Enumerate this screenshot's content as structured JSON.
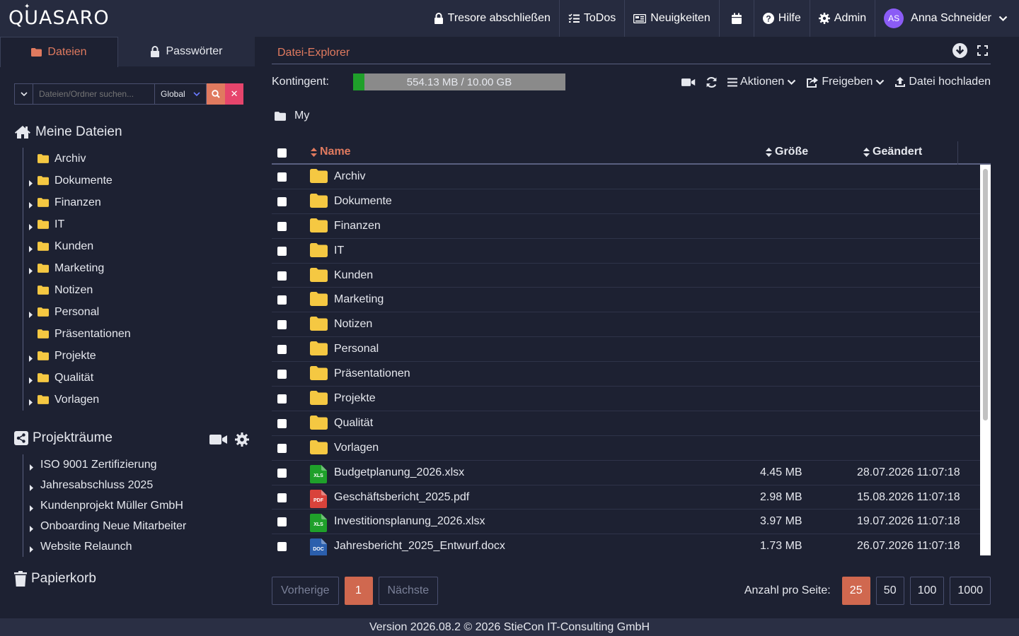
{
  "app": {
    "logo": "QUASARO"
  },
  "topnav": {
    "lock_vaults": "Tresore abschließen",
    "todos": "ToDos",
    "news": "Neuigkeiten",
    "help": "Hilfe",
    "admin": "Admin",
    "user_initials": "AS",
    "user_name": "Anna Schneider"
  },
  "left_tabs": {
    "files": "Dateien",
    "passwords": "Passwörter"
  },
  "search": {
    "placeholder": "Dateien/Ordner suchen...",
    "scope": "Global"
  },
  "my_files": {
    "title": "Meine Dateien",
    "folders": [
      {
        "label": "Archiv",
        "expandable": false
      },
      {
        "label": "Dokumente",
        "expandable": true
      },
      {
        "label": "Finanzen",
        "expandable": true
      },
      {
        "label": "IT",
        "expandable": true
      },
      {
        "label": "Kunden",
        "expandable": true
      },
      {
        "label": "Marketing",
        "expandable": true
      },
      {
        "label": "Notizen",
        "expandable": false
      },
      {
        "label": "Personal",
        "expandable": true
      },
      {
        "label": "Präsentationen",
        "expandable": false
      },
      {
        "label": "Projekte",
        "expandable": true
      },
      {
        "label": "Qualität",
        "expandable": true
      },
      {
        "label": "Vorlagen",
        "expandable": true
      }
    ]
  },
  "project_rooms": {
    "title": "Projekträume",
    "items": [
      "ISO 9001 Zertifizierung",
      "Jahresabschluss 2025",
      "Kundenprojekt Müller GmbH",
      "Onboarding Neue Mitarbeiter",
      "Website Relaunch"
    ]
  },
  "trash": {
    "title": "Papierkorb"
  },
  "explorer": {
    "tab": "Datei-Explorer",
    "quota_label": "Kontingent:",
    "quota_text": "554.13 MB / 10.00 GB",
    "quota_fraction": 0.054,
    "actions": {
      "actions": "Aktionen",
      "share": "Freigeben",
      "upload": "Datei hochladen"
    },
    "breadcrumb": "My",
    "columns": {
      "name": "Name",
      "size": "Größe",
      "modified": "Geändert"
    },
    "rows": [
      {
        "type": "folder",
        "name": "Archiv",
        "size": "",
        "modified": ""
      },
      {
        "type": "folder",
        "name": "Dokumente",
        "size": "",
        "modified": ""
      },
      {
        "type": "folder",
        "name": "Finanzen",
        "size": "",
        "modified": ""
      },
      {
        "type": "folder",
        "name": "IT",
        "size": "",
        "modified": ""
      },
      {
        "type": "folder",
        "name": "Kunden",
        "size": "",
        "modified": ""
      },
      {
        "type": "folder",
        "name": "Marketing",
        "size": "",
        "modified": ""
      },
      {
        "type": "folder",
        "name": "Notizen",
        "size": "",
        "modified": ""
      },
      {
        "type": "folder",
        "name": "Personal",
        "size": "",
        "modified": ""
      },
      {
        "type": "folder",
        "name": "Präsentationen",
        "size": "",
        "modified": ""
      },
      {
        "type": "folder",
        "name": "Projekte",
        "size": "",
        "modified": ""
      },
      {
        "type": "folder",
        "name": "Qualität",
        "size": "",
        "modified": ""
      },
      {
        "type": "folder",
        "name": "Vorlagen",
        "size": "",
        "modified": ""
      },
      {
        "type": "xls",
        "badge": "XLS",
        "name": "Budgetplanung_2026.xlsx",
        "size": "4.45 MB",
        "modified": "28.07.2026 11:07:18"
      },
      {
        "type": "pdf",
        "badge": "PDF",
        "name": "Geschäftsbericht_2025.pdf",
        "size": "2.98 MB",
        "modified": "15.08.2026 11:07:18"
      },
      {
        "type": "xls",
        "badge": "XLS",
        "name": "Investitionsplanung_2026.xlsx",
        "size": "3.97 MB",
        "modified": "19.07.2026 11:07:18"
      },
      {
        "type": "doc",
        "badge": "DOC",
        "name": "Jahresbericht_2025_Entwurf.docx",
        "size": "1.73 MB",
        "modified": "26.07.2026 11:07:18"
      }
    ],
    "pager": {
      "prev": "Vorherige",
      "current": "1",
      "next": "Nächste"
    },
    "per_page": {
      "label": "Anzahl pro Seite:",
      "options": [
        "25",
        "50",
        "100",
        "1000"
      ],
      "selected": "25"
    }
  },
  "footer": {
    "text": "Version 2026.08.2 © 2026 StieCon IT-Consulting GmbH"
  },
  "colors": {
    "accent": "#e07a5f",
    "folder": "#f5c842",
    "xls": "#1fa02a",
    "pdf": "#d9433b",
    "doc": "#2b5fad"
  }
}
